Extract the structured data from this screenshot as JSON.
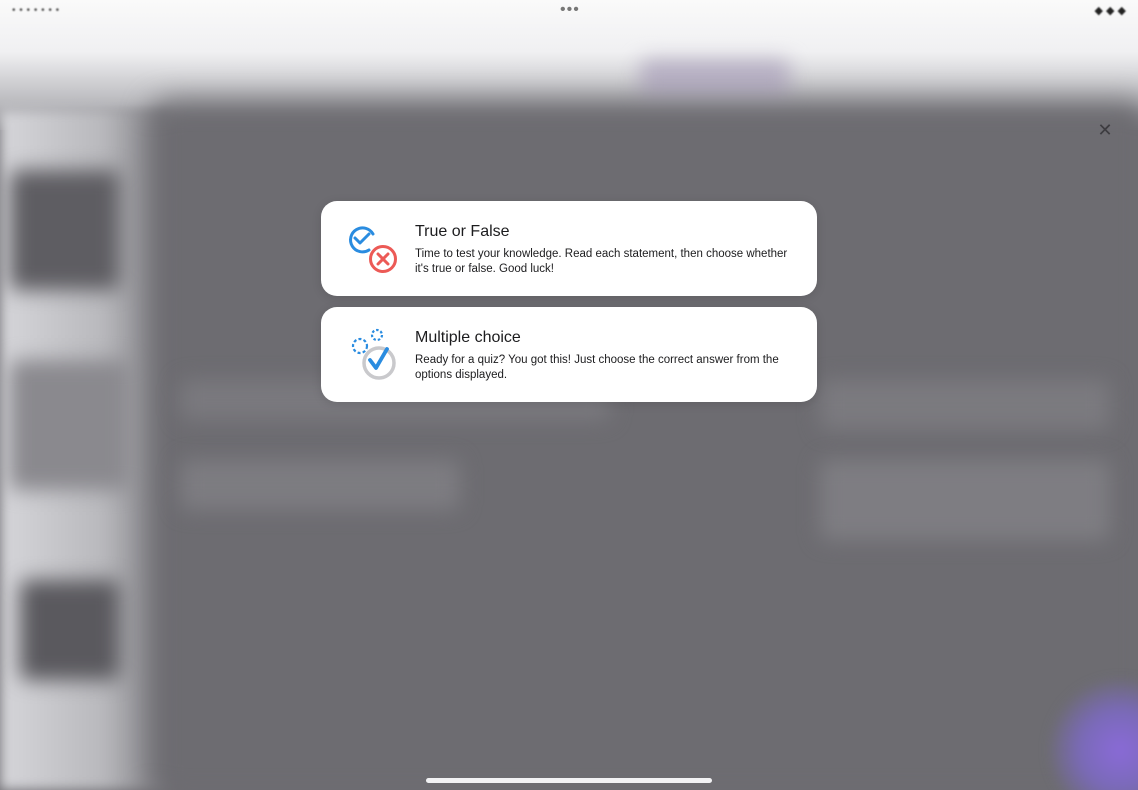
{
  "status_bar": {
    "left_text": "• • • • • • •",
    "right_text": "◆ ◆ ◆",
    "menu_dots": "•••"
  },
  "close": {
    "glyph": "✕",
    "icon": "close-icon"
  },
  "options": [
    {
      "title": "True or False",
      "description": "Time to test your knowledge. Read each statement, then choose whether it's true or false. Good luck!",
      "icon": "true-false-icon"
    },
    {
      "title": "Multiple choice",
      "description": "Ready for a quiz? You got this! Just choose the correct answer from the options displayed.",
      "icon": "multiple-choice-icon"
    }
  ],
  "colors": {
    "blue": "#2a8ce0",
    "red": "#ec5a56",
    "gray": "#c9c9cc",
    "card_bg": "#ffffff",
    "overlay": "#6e6d72"
  }
}
